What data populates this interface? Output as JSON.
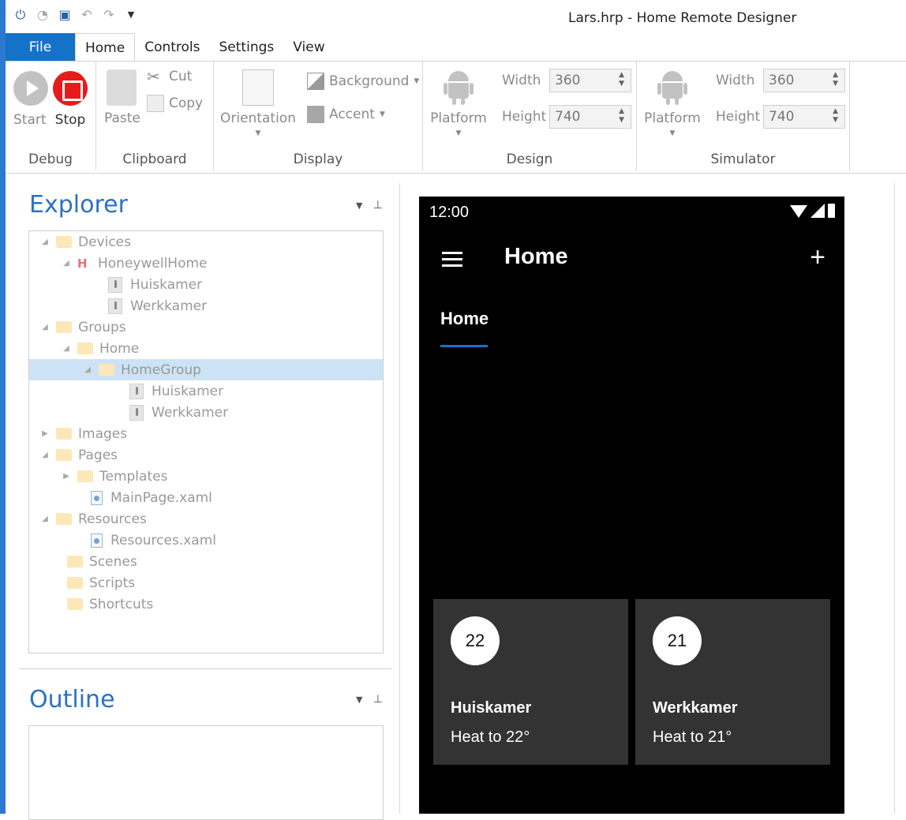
{
  "window": {
    "title": "Lars.hrp - Home Remote Designer"
  },
  "tabs": [
    "File",
    "Home",
    "Controls",
    "Settings",
    "View"
  ],
  "ribbon": {
    "debug": {
      "label": "Debug",
      "start": "Start",
      "stop": "Stop"
    },
    "clipboard": {
      "label": "Clipboard",
      "paste": "Paste",
      "cut": "Cut",
      "copy": "Copy"
    },
    "display": {
      "label": "Display",
      "orientation": "Orientation",
      "background": "Background",
      "accent": "Accent"
    },
    "design": {
      "label": "Design",
      "platform": "Platform",
      "width_label": "Width",
      "width": "360",
      "height_label": "Height",
      "height": "740"
    },
    "simulator": {
      "label": "Simulator",
      "platform": "Platform",
      "width_label": "Width",
      "width": "360",
      "height_label": "Height",
      "height": "740"
    }
  },
  "explorer": {
    "title": "Explorer",
    "nodes": [
      {
        "label": "Devices"
      },
      {
        "label": "HoneywellHome"
      },
      {
        "label": "Huiskamer"
      },
      {
        "label": "Werkkamer"
      },
      {
        "label": "Groups"
      },
      {
        "label": "Home"
      },
      {
        "label": "HomeGroup"
      },
      {
        "label": "Huiskamer"
      },
      {
        "label": "Werkkamer"
      },
      {
        "label": "Images"
      },
      {
        "label": "Pages"
      },
      {
        "label": "Templates"
      },
      {
        "label": "MainPage.xaml"
      },
      {
        "label": "Resources"
      },
      {
        "label": "Resources.xaml"
      },
      {
        "label": "Scenes"
      },
      {
        "label": "Scripts"
      },
      {
        "label": "Shortcuts"
      }
    ]
  },
  "outline": {
    "title": "Outline"
  },
  "phone": {
    "time": "12:00",
    "app_title": "Home",
    "tab": "Home",
    "tiles": [
      {
        "value": "22",
        "name": "Huiskamer",
        "status": "Heat to 22°"
      },
      {
        "value": "21",
        "name": "Werkkamer",
        "status": "Heat to 21°"
      }
    ]
  }
}
